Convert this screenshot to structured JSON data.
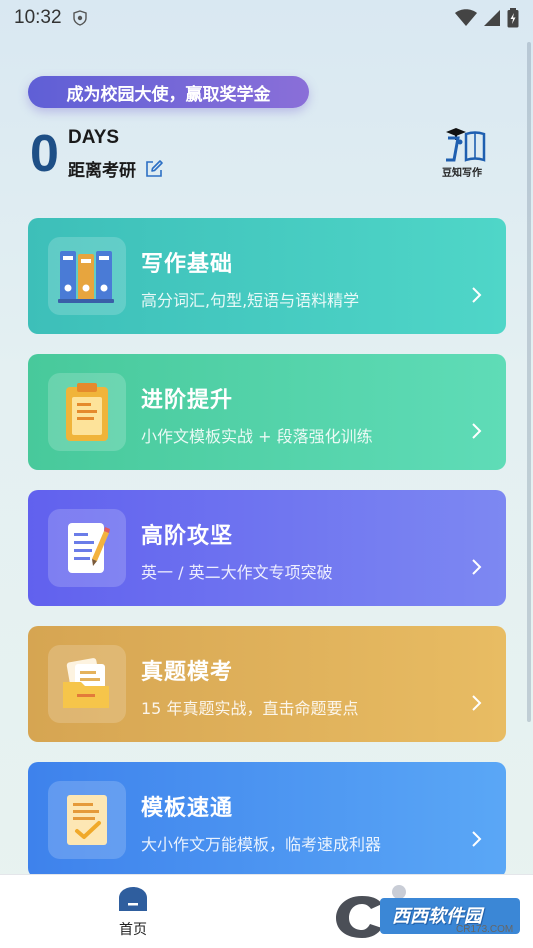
{
  "status_bar": {
    "time": "10:32"
  },
  "banner": {
    "label": "成为校园大使，赢取奖学金"
  },
  "countdown": {
    "number": "0",
    "unit": "DAYS",
    "caption": "距离考研"
  },
  "logo": {
    "text": "豆知写作"
  },
  "cards": [
    {
      "title": "写作基础",
      "subtitle": "高分词汇,句型,短语与语料精学",
      "icon": "books-icon"
    },
    {
      "title": "进阶提升",
      "subtitle": "小作文模板实战 + 段落强化训练",
      "icon": "clipboard-icon"
    },
    {
      "title": "高阶攻坚",
      "subtitle": "英一 / 英二大作文专项突破",
      "icon": "document-pencil-icon"
    },
    {
      "title": "真题模考",
      "subtitle": "15 年真题实战，直击命题要点",
      "icon": "folder-papers-icon"
    },
    {
      "title": "模板速通",
      "subtitle": "大小作文万能模板，临考速成利器",
      "icon": "checklist-icon"
    }
  ],
  "tabbar": {
    "home_label": "首页"
  },
  "watermark": {
    "brand": "西西软件园",
    "site": "CR173.COM"
  },
  "colors": {
    "accent": "#1e4f86",
    "banner_start": "#5f5fd6",
    "card1": "#3dbfb9",
    "card2": "#48c99b",
    "card3": "#6161ee",
    "card4": "#d6a552",
    "card5": "#3e82ec"
  }
}
